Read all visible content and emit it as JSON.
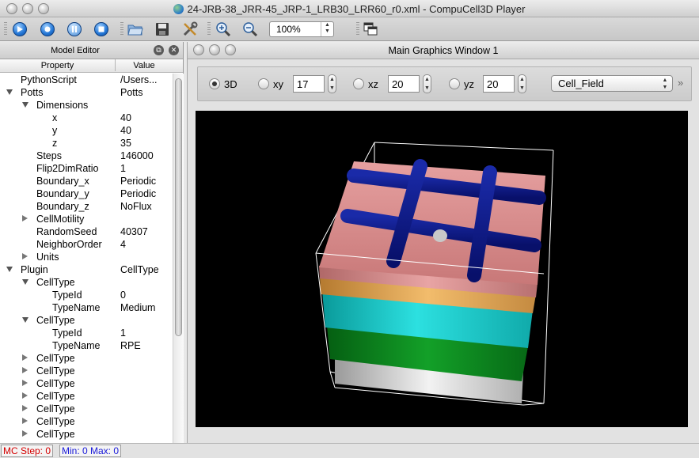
{
  "window": {
    "title": "24-JRB-38_JRR-45_JRP-1_LRB30_LRR60_r0.xml - CompuCell3D Player"
  },
  "toolbar": {
    "buttons": [
      "run-icon",
      "step-icon",
      "pause-icon",
      "stop-icon",
      "open-folder-icon",
      "save-icon",
      "tools-icon",
      "zoom-in-icon",
      "zoom-out-icon",
      "window-tile-icon"
    ],
    "zoom_value": "100%"
  },
  "model_editor": {
    "title": "Model Editor",
    "col_property": "Property",
    "col_value": "Value",
    "rows": [
      {
        "prop": "PythonScript",
        "val": "/Users..."
      },
      {
        "prop": "Potts",
        "val": "Potts"
      },
      {
        "prop": "Dimensions",
        "val": ""
      },
      {
        "prop": "x",
        "val": "40"
      },
      {
        "prop": "y",
        "val": "40"
      },
      {
        "prop": "z",
        "val": "35"
      },
      {
        "prop": "Steps",
        "val": "146000"
      },
      {
        "prop": "Flip2DimRatio",
        "val": "1"
      },
      {
        "prop": "Boundary_x",
        "val": "Periodic"
      },
      {
        "prop": "Boundary_y",
        "val": "Periodic"
      },
      {
        "prop": "Boundary_z",
        "val": "NoFlux"
      },
      {
        "prop": "CellMotility",
        "val": ""
      },
      {
        "prop": "RandomSeed",
        "val": "40307"
      },
      {
        "prop": "NeighborOrder",
        "val": "4"
      },
      {
        "prop": "Units",
        "val": ""
      },
      {
        "prop": "Plugin",
        "val": "CellType"
      },
      {
        "prop": "CellType",
        "val": ""
      },
      {
        "prop": "TypeId",
        "val": "0"
      },
      {
        "prop": "TypeName",
        "val": "Medium"
      },
      {
        "prop": "CellType",
        "val": ""
      },
      {
        "prop": "TypeId",
        "val": "1"
      },
      {
        "prop": "TypeName",
        "val": "RPE"
      },
      {
        "prop": "CellType",
        "val": ""
      },
      {
        "prop": "CellType",
        "val": ""
      },
      {
        "prop": "CellType",
        "val": ""
      },
      {
        "prop": "CellType",
        "val": ""
      },
      {
        "prop": "CellType",
        "val": ""
      },
      {
        "prop": "CellType",
        "val": ""
      },
      {
        "prop": "CellType",
        "val": ""
      }
    ]
  },
  "graphics": {
    "title": "Main Graphics Window 1",
    "views": {
      "d3_label": "3D",
      "xy_label": "xy",
      "xy_value": "17",
      "xz_label": "xz",
      "xz_value": "20",
      "yz_label": "yz",
      "yz_value": "20"
    },
    "field": "Cell_Field",
    "extension": "»"
  },
  "status": {
    "mc_step": "MC Step: 0",
    "min_max": "Min: 0 Max: 0"
  },
  "colors": {
    "mc_step": "#d40000",
    "min_max": "#1a1ad8",
    "pink_layer": "#d88a8a",
    "blue_network": "#0f1a8f",
    "orange_layer": "#e8a858",
    "cyan_layer": "#14c8c8",
    "green_layer": "#0a8a1e",
    "white_layer": "#d0d0d0"
  }
}
